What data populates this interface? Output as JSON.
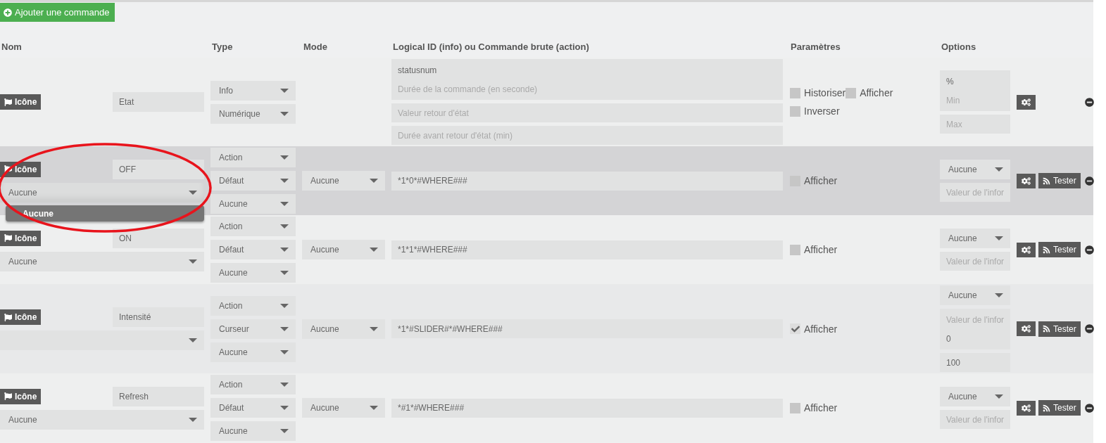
{
  "add_button": "Ajouter une commande",
  "columns": [
    "Nom",
    "Type",
    "Mode",
    "Logical ID (info) ou Commande brute (action)",
    "Paramètres",
    "Options"
  ],
  "rows": [
    {
      "highlighted": false,
      "icon_button": "Icône",
      "name": "Etat",
      "types": [
        "Info",
        "Numérique"
      ],
      "logical": [
        [
          {
            "value": "statusnum"
          },
          {
            "placeholder": "Durée de la commande (en seconde)"
          }
        ],
        [
          {
            "placeholder": "Valeur retour d'état"
          }
        ],
        [
          {
            "placeholder": "Durée avant retour d'état (min)"
          }
        ]
      ],
      "params": [
        {
          "label": "Historiser",
          "checked": false
        },
        {
          "label": "Afficher",
          "checked": false
        },
        {
          "label": "Inverser",
          "checked": false
        }
      ],
      "options": [
        {
          "kind": "box",
          "lines": [
            {
              "value": "%"
            },
            {
              "placeholder": "Min"
            }
          ]
        },
        {
          "kind": "box",
          "lines": [
            {
              "placeholder": "Max"
            }
          ]
        }
      ]
    },
    {
      "highlighted": true,
      "icon_button": "Icône",
      "name": "OFF",
      "name_select": {
        "value": "Aucune",
        "expanded": true,
        "options": [
          {
            "label": "Aucune",
            "selected": true
          }
        ]
      },
      "types": [
        "Action",
        "Défaut",
        "Aucune"
      ],
      "mode": "Aucune",
      "logical": [
        [
          {
            "value": "*1*0*#WHERE###"
          }
        ]
      ],
      "params": [
        {
          "label": "Afficher",
          "checked": false
        }
      ],
      "options": [
        {
          "kind": "select",
          "value": "Aucune"
        },
        {
          "kind": "box",
          "lines": [
            {
              "placeholder": "Valeur de l'infor"
            }
          ]
        }
      ],
      "test_button": "Tester"
    },
    {
      "highlighted": false,
      "icon_button": "Icône",
      "name": "ON",
      "name_select": {
        "value": "Aucune",
        "expanded": false
      },
      "types": [
        "Action",
        "Défaut",
        "Aucune"
      ],
      "mode": "Aucune",
      "logical": [
        [
          {
            "value": "*1*1*#WHERE###"
          }
        ]
      ],
      "params": [
        {
          "label": "Afficher",
          "checked": false
        }
      ],
      "options": [
        {
          "kind": "select",
          "value": "Aucune"
        },
        {
          "kind": "box",
          "lines": [
            {
              "placeholder": "Valeur de l'infor"
            }
          ]
        }
      ],
      "test_button": "Tester"
    },
    {
      "highlighted": false,
      "icon_button": "Icône",
      "name": "Intensité",
      "name_select": {
        "expanded": false
      },
      "types": [
        "Action",
        "Curseur",
        "Aucune"
      ],
      "mode": "Aucune",
      "logical": [
        [
          {
            "value": "*1*#SLIDER#*#WHERE###"
          }
        ]
      ],
      "params": [
        {
          "label": "Afficher",
          "checked": true
        }
      ],
      "options": [
        {
          "kind": "select",
          "value": "Aucune"
        },
        {
          "kind": "box",
          "lines": [
            {
              "placeholder": "Valeur de l'infor"
            },
            {
              "value": "0"
            }
          ]
        },
        {
          "kind": "box",
          "lines": [
            {
              "value": "100"
            }
          ]
        }
      ],
      "test_button": "Tester"
    },
    {
      "highlighted": false,
      "icon_button": "Icône",
      "name": "Refresh",
      "name_select": {
        "value": "Aucune",
        "expanded": false
      },
      "types": [
        "Action",
        "Défaut",
        "Aucune"
      ],
      "mode": "Aucune",
      "logical": [
        [
          {
            "value": "*#1*#WHERE###"
          }
        ]
      ],
      "params": [
        {
          "label": "Afficher",
          "checked": false
        }
      ],
      "options": [
        {
          "kind": "select",
          "value": "Aucune"
        },
        {
          "kind": "box",
          "lines": [
            {
              "placeholder": "Valeur de l'infor"
            }
          ]
        }
      ],
      "test_button": "Tester"
    }
  ]
}
